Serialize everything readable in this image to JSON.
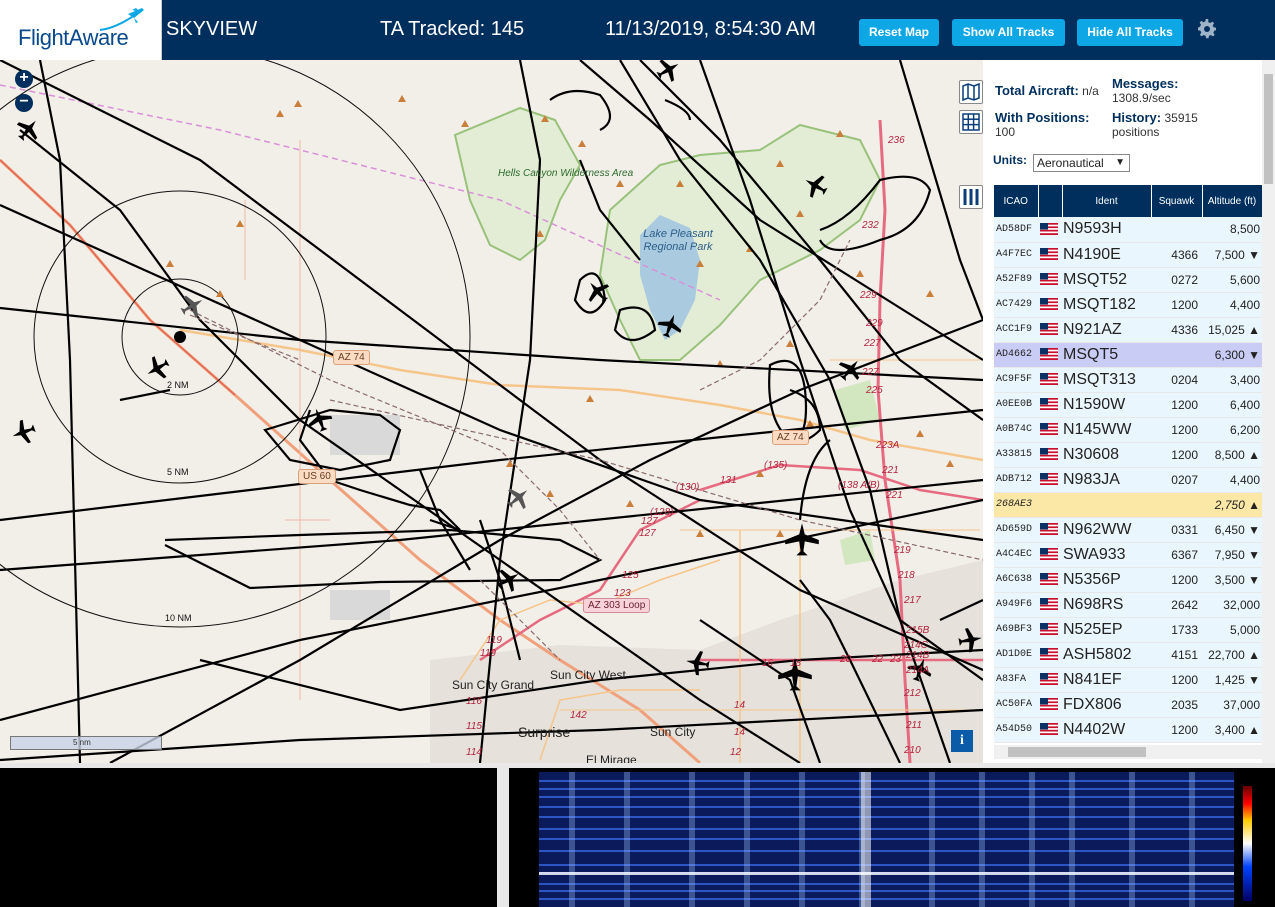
{
  "header": {
    "logo_text": "FlightAware",
    "app_name": "SKYVIEW",
    "tracked": "TA Tracked: 145",
    "datetime": "11/13/2019, 8:54:30 AM",
    "reset_label": "Reset Map",
    "show_label": "Show All Tracks",
    "hide_label": "Hide All Tracks",
    "settings_icon": "gear-icon"
  },
  "map": {
    "labels": {
      "hells_canyon": "Hells Canyon Wilderness Area",
      "lake_pleasant": "Lake Pleasant Regional Park",
      "sun_city_grand": "Sun City Grand",
      "sun_city_west": "Sun City West",
      "surprise": "Surprise",
      "sun_city": "Sun City",
      "el_mirage": "El Mirage"
    },
    "roads": {
      "az74": "AZ 74",
      "az74b": "AZ 74",
      "us60": "US 60",
      "az303": "AZ 303 Loop"
    },
    "rings": {
      "r2": "2 NM",
      "r5": "5 NM",
      "r10": "10 NM"
    },
    "route_numbers": [
      "236",
      "232",
      "229",
      "229",
      "227",
      "227",
      "225",
      "223A",
      "221",
      "221",
      "219",
      "218",
      "217",
      "215B",
      "214C",
      "214B",
      "214A",
      "212",
      "211",
      "210",
      "(135)",
      "(130)",
      "131",
      "(128)",
      "127",
      "127",
      "125",
      "123",
      "119",
      "119",
      "116",
      "115",
      "114",
      "142",
      "(138 A/B)",
      "14",
      "16",
      "18",
      "20",
      "22",
      "23",
      "14",
      "12"
    ],
    "scale": "5 nm",
    "info": "i"
  },
  "sidebar": {
    "total_label": "Total Aircraft:",
    "total_value": "n/a",
    "messages_label": "Messages:",
    "messages_value": "1308.9/sec",
    "positions_label": "With Positions:",
    "positions_value": "100",
    "history_label": "History:",
    "history_value": "35915 positions",
    "units_label": "Units:",
    "units_value": "Aeronautical",
    "columns": [
      "ICAO",
      "",
      "Ident",
      "Squawk",
      "Altitude (ft)"
    ],
    "rows": [
      {
        "icao": "AD58DF",
        "ident": "N9593H",
        "squawk": "",
        "alt": "8,500"
      },
      {
        "icao": "A4F7EC",
        "ident": "N4190E",
        "squawk": "4366",
        "alt": "7,500 ▼"
      },
      {
        "icao": "A52F89",
        "ident": "MSQT52",
        "squawk": "0272",
        "alt": "5,600"
      },
      {
        "icao": "AC7429",
        "ident": "MSQT182",
        "squawk": "1200",
        "alt": "4,400"
      },
      {
        "icao": "ACC1F9",
        "ident": "N921AZ",
        "squawk": "4336",
        "alt": "15,025 ▲"
      },
      {
        "icao": "AD4662",
        "ident": "MSQT5",
        "squawk": "",
        "alt": "6,300 ▼"
      },
      {
        "icao": "AC9F5F",
        "ident": "MSQT313",
        "squawk": "0204",
        "alt": "3,400"
      },
      {
        "icao": "A0EE0B",
        "ident": "N1590W",
        "squawk": "1200",
        "alt": "6,400"
      },
      {
        "icao": "A0B74C",
        "ident": "N145WW",
        "squawk": "1200",
        "alt": "6,200"
      },
      {
        "icao": "A33815",
        "ident": "N30608",
        "squawk": "1200",
        "alt": "8,500 ▲"
      },
      {
        "icao": "ADB712",
        "ident": "N983JA",
        "squawk": "0207",
        "alt": "4,400"
      },
      {
        "icao": "268AE3",
        "ident": "",
        "squawk": "",
        "alt": "2,750 ▲"
      },
      {
        "icao": "AD659D",
        "ident": "N962WW",
        "squawk": "0331",
        "alt": "6,450 ▼"
      },
      {
        "icao": "A4C4EC",
        "ident": "SWA933",
        "squawk": "6367",
        "alt": "7,950 ▼"
      },
      {
        "icao": "A6C638",
        "ident": "N5356P",
        "squawk": "1200",
        "alt": "3,500 ▼"
      },
      {
        "icao": "A949F6",
        "ident": "N698RS",
        "squawk": "2642",
        "alt": "32,000"
      },
      {
        "icao": "A69BF3",
        "ident": "N525EP",
        "squawk": "1733",
        "alt": "5,000"
      },
      {
        "icao": "AD1D0E",
        "ident": "ASH5802",
        "squawk": "4151",
        "alt": "22,700 ▲"
      },
      {
        "icao": "A83FA",
        "ident": "N841EF",
        "squawk": "1200",
        "alt": "1,425 ▼"
      },
      {
        "icao": "AC50FA",
        "ident": "FDX806",
        "squawk": "2035",
        "alt": "37,000"
      },
      {
        "icao": "A54D50",
        "ident": "N4402W",
        "squawk": "1200",
        "alt": "3,400 ▲"
      }
    ]
  },
  "colors": {
    "header_bg": "#002f5d",
    "button": "#0da7e6",
    "selected_row": "#c9cdf5",
    "highlight_row": "#fce8a6"
  }
}
